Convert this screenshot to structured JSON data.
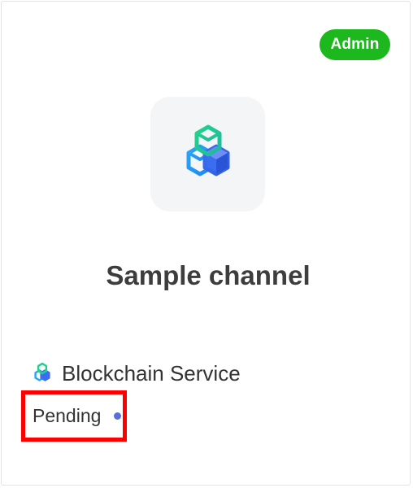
{
  "card": {
    "badge": "Admin",
    "icon": "blockchain-cubes-icon",
    "title": "Sample channel",
    "service": {
      "icon": "blockchain-cubes-icon",
      "label": "Blockchain Service"
    },
    "status": {
      "label": "Pending",
      "indicator_color": "#5b6ed8"
    }
  },
  "colors": {
    "badge_bg": "#1db81d",
    "highlight_border": "#ff0000",
    "cube_green": "#21c98a",
    "cube_blue": "#2f7cf0"
  }
}
